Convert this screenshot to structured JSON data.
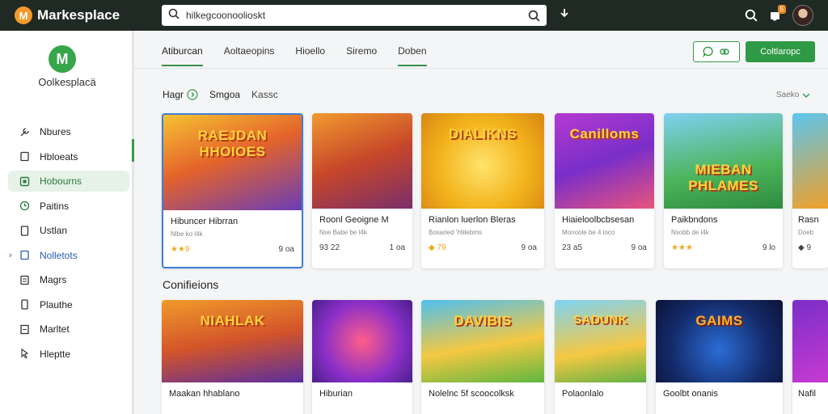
{
  "topbar": {
    "brand_logo_letter": "M",
    "brand_name": "Markesplace",
    "search_value": "hilkegcoonoolioskt",
    "notif_count": "5"
  },
  "sidebar": {
    "logo_letter": "M",
    "brand_label": "Oolkesplacä",
    "items": [
      {
        "label": "Nbures",
        "icon": "wrench-icon"
      },
      {
        "label": "Hbloeats",
        "icon": "document-icon"
      },
      {
        "label": "Hobourns",
        "icon": "square-icon"
      },
      {
        "label": "Paitins",
        "icon": "clock-icon"
      },
      {
        "label": "Ustlan",
        "icon": "tablet-icon"
      },
      {
        "label": "Nolletots",
        "icon": "doc-icon"
      },
      {
        "label": "Magrs",
        "icon": "notes-icon"
      },
      {
        "label": "Plauthe",
        "icon": "phone-icon"
      },
      {
        "label": "Marltet",
        "icon": "list-icon"
      },
      {
        "label": "Hleptte",
        "icon": "pointer-icon"
      }
    ],
    "active_index": 2
  },
  "tabs": [
    {
      "label": "Atiburcan"
    },
    {
      "label": "Aoltaeopins"
    },
    {
      "label": "Hioello"
    },
    {
      "label": "Siremo"
    },
    {
      "label": "Doben"
    }
  ],
  "actions": {
    "primary_label": "Coltlaropc"
  },
  "filters": [
    {
      "label": "Hagr"
    },
    {
      "label": "Smgoa"
    },
    {
      "label": "Kassc"
    }
  ],
  "sort_label": "Saeko",
  "colors": {
    "topbar": "#1f2a24",
    "accent_green": "#2f9a46",
    "selected_blue": "#3f7fd6",
    "brand_orange": "#f39a2b"
  },
  "row1": [
    {
      "thumb_text": "RAEJDAN HHOIOES",
      "title": "Hibuncer Hibrran",
      "sub": "Nlbe ko l4k",
      "rating": "★★9",
      "price": "9 oa",
      "bg": "linear-gradient(160deg,#f6c233,#e4632a 45%,#6a3db8)"
    },
    {
      "thumb_text": "",
      "title": "Roonl Geoigne M",
      "sub": "Nse\nBabe be l4k",
      "rating": "93 22",
      "price": "1 oa",
      "bg": "linear-gradient(160deg,#f19a2e,#c6462a 50%,#7a2f6b)"
    },
    {
      "thumb_text": "DIALIKNS",
      "title": "Rianlon luerlon Bleras",
      "sub": "Bosaried 'Hiilebms",
      "rating": "◆ 79",
      "price": "9 oa",
      "bg": "radial-gradient(circle at 50% 55%,#ffe36b,#f2b31c 55%,#d88613)"
    },
    {
      "thumb_text": "Canilloms",
      "title": "Hiaieloolbcbsesan",
      "sub": "Monoole be 4 loco",
      "rating": "23 a5",
      "price": "9 oa",
      "bg": "linear-gradient(160deg,#b43ad1,#7a2ec9 50%,#e8557c)"
    },
    {
      "thumb_text": "MIEBAN PHLAMES",
      "title": "Paikbndons",
      "sub": "Nsobb de l4k",
      "rating": "★★★",
      "price": "9 lo",
      "bg": "linear-gradient(170deg,#7fd0f2,#4cb45a 60%,#2e8a3f)"
    },
    {
      "thumb_text": "",
      "title": "Rasn",
      "sub": "Doeb",
      "rating": "◆ 9",
      "price": "",
      "bg": "linear-gradient(160deg,#5bc6ef,#f0a02a)"
    }
  ],
  "section_title": "Conifieions",
  "row2": [
    {
      "thumb_text": "NIAHLAK",
      "title": "Maakan hhablano",
      "bg": "linear-gradient(170deg,#f09a2a,#d3542a 50%,#5a2ea0)"
    },
    {
      "thumb_text": "",
      "title": "Hiburian",
      "bg": "radial-gradient(circle at 50% 50%,#ff5d8a,#8a2fc8 60%,#4a1f8a)"
    },
    {
      "thumb_text": "DAVIBIS",
      "title": "Nolelnc 5f scoocolksk",
      "bg": "linear-gradient(170deg,#4fc0ef,#f5c842 55%,#5fb640)"
    },
    {
      "thumb_text": "SADUNK",
      "title": "Polaonlalo",
      "bg": "linear-gradient(170deg,#7fd3f5,#f5c842 60%,#63b145)"
    },
    {
      "thumb_text": "GAIMS",
      "title": "Goolbt onanis",
      "bg": "radial-gradient(circle at 50% 60%,#2b6dd6,#142a6a 60%,#0c1336)"
    },
    {
      "thumb_text": "",
      "title": "Nafil",
      "bg": "linear-gradient(160deg,#7a2ec9,#c63ad1)"
    }
  ]
}
